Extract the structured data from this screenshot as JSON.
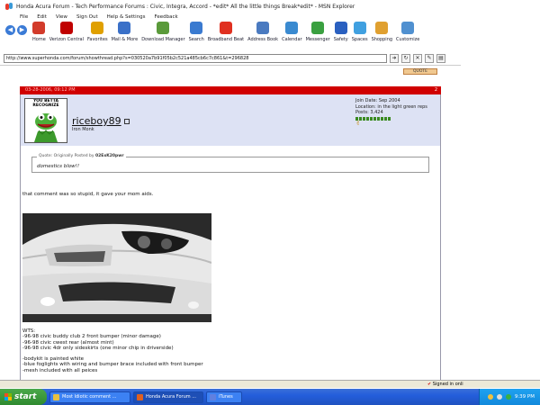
{
  "window": {
    "title": "Honda Acura Forum - Tech Performance Forums : Civic, Integra, Accord - *edit* All the little things Break*edit* - MSN Explorer"
  },
  "menu": [
    "File",
    "Edit",
    "View",
    "Sign Out",
    "Help & Settings",
    "Feedback"
  ],
  "toolbar": [
    {
      "label": "Home",
      "icon": "home-icon",
      "color": "#d23b2b"
    },
    {
      "label": "Verizon Central",
      "icon": "verizon-icon",
      "color": "#c00000"
    },
    {
      "label": "Favorites",
      "icon": "star-icon",
      "color": "#e0a000"
    },
    {
      "label": "Mail & More",
      "icon": "mail-icon",
      "color": "#3a70c8"
    },
    {
      "label": "Download Manager",
      "icon": "download-icon",
      "color": "#5a9a3a"
    },
    {
      "label": "Search",
      "icon": "search-icon",
      "color": "#3a7ad0"
    },
    {
      "label": "Broadband Beat",
      "icon": "bb-icon",
      "color": "#e03020"
    },
    {
      "label": "Address Book",
      "icon": "address-book-icon",
      "color": "#4a7ac0"
    },
    {
      "label": "Calendar",
      "icon": "calendar-icon",
      "color": "#3a8ad0"
    },
    {
      "label": "Messenger",
      "icon": "messenger-icon",
      "color": "#3aa040"
    },
    {
      "label": "Safety",
      "icon": "safety-icon",
      "color": "#2a60c0"
    },
    {
      "label": "Spaces",
      "icon": "spaces-icon",
      "color": "#40a0e0"
    },
    {
      "label": "Shopping",
      "icon": "shopping-icon",
      "color": "#e0a030"
    },
    {
      "label": "Customize",
      "icon": "customize-icon",
      "color": "#5090d0"
    }
  ],
  "address": {
    "url": "http://www.superhonda.com/forum/showthread.php?s=030520a7b91f05b2c521a485cb6c7c861&t=296828"
  },
  "post": {
    "quote_button": "QUOTE",
    "header_date": "03-28-2006, 09:12 PM",
    "header_number": "2",
    "avatar_caption": "YOU BETTA RECOGNIZE",
    "username": "riceboy89",
    "user_title": "Iron Monk",
    "join_date": "Join Date: Sep 2004",
    "location": "Location: in the light green reps",
    "posts": "Posts: 3,424",
    "rep_level": 10,
    "quote_by_prefix": "Quote: Originally Posted by",
    "quote_author": "02ExK20pwr",
    "quote_text": "domestics blow!!",
    "reply_text": "that comment was so stupid, it gave your mom aids.",
    "list": [
      "WTS:",
      "-96-98 civic buddy club 2 front bumper (minor damage)",
      "-96-98 civic cwest rear (almost mint)",
      "-96-98 civic 4dr only sideskirts (one minor chip in driverside)",
      "",
      "-bodykit is painted white",
      "-blue foglights with wiring and bumper brace included with front bumper",
      "-mesh included with all peices"
    ]
  },
  "status": {
    "signed_in": "Signed in onli"
  },
  "taskbar": {
    "start": "start",
    "tasks": [
      {
        "label": "Most Idiotic comment ...",
        "active": false,
        "color": "#e8c040"
      },
      {
        "label": "Honda Acura Forum ...",
        "active": true,
        "color": "#e06020"
      },
      {
        "label": "iTunes",
        "active": false,
        "color": "#6080e0"
      }
    ],
    "clock": "9:39 PM"
  }
}
